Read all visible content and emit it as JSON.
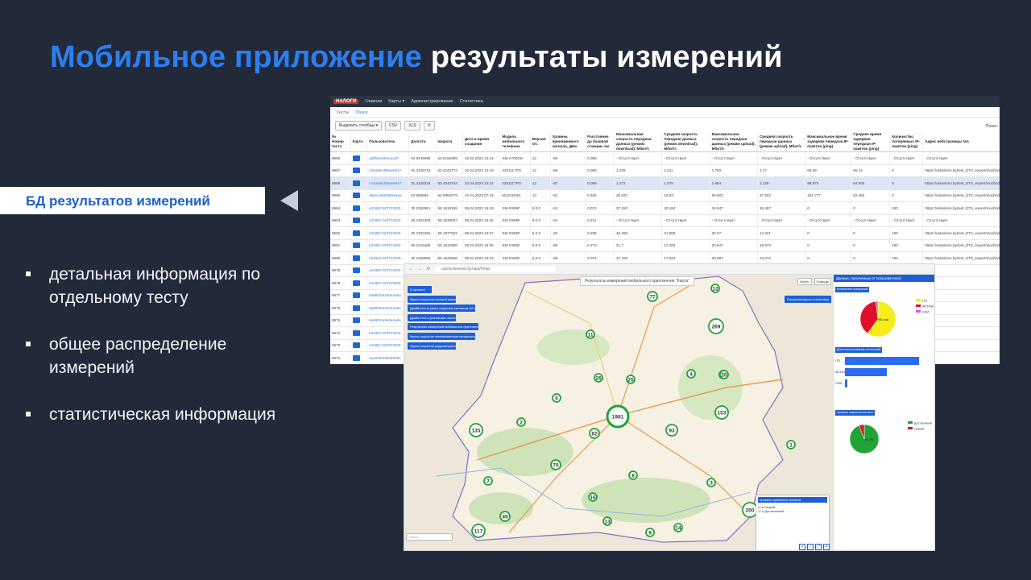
{
  "slide": {
    "title_highlight": "Мобильное приложение",
    "title_rest": "результаты измерений",
    "db_label": "БД результатов измерений",
    "bullets": [
      "детальная информация по отдельному тесту",
      "общее распределение измерений",
      "статистическая информация"
    ]
  },
  "colors": {
    "background": "#222a39",
    "accent": "#2d7ef0",
    "panel_blue": "#1f5fd6"
  },
  "web": {
    "logo": "НАЛОГИ",
    "menu": [
      "Главная",
      "Карты ▾",
      "Администрирование",
      "Статистика"
    ],
    "tabs": [
      "Тесты",
      "Поиск"
    ],
    "tool_buttons": [
      "Выделить столбцы ▾",
      "CSV",
      "XLS"
    ],
    "search_label": "Поиск:",
    "columns": [
      "№ Номер теста",
      "Карта",
      "Пользователь",
      "Долгота",
      "Широта",
      "Дата и время создания",
      "Модель мобильного телефона",
      "Версия ОС",
      "Уровень принимаемого сигнала, дБм",
      "Расстояние до базовой станции, км",
      "Максимальная скорость передачи данных (режим download), Мбит/с",
      "Средняя скорость передачи данных (режим download), Мбит/с",
      "Максимальная скорость передачи данных (режим upload), Мбит/с",
      "Средняя скорость передачи данных (режим upload), Мбит/с",
      "Максимальное время задержки передачи IP-пакетов (ping)",
      "Среднее время задержки передачи IP-пакетов (ping)",
      "Количество потерянных IP-пакетов (ping)",
      "Адрес вебстраницы №1",
      "Время загрузки вебстраницы №1, с",
      "Размер вебстраницы №1, кб",
      "Адрес вебстраницы №2"
    ],
    "rows": [
      [
        "9988",
        "a30f6ec6fe5acd2f",
        "53.9436995",
        "53.9150089",
        "10.04.2023 13:44",
        "SM-A705GE",
        "13",
        "-89",
        "0.008",
        "- Отсутствует",
        "- Отсутствует",
        "- Отсутствует",
        "- Отсутствует",
        "- Отсутствует",
        "- Отсутствует",
        "- Отсутствует",
        "- Отсутствует",
        "- Отсутствует",
        "- Отсутствует",
        "- Отсутствует"
      ],
      [
        "9987",
        "c44a58cd59ae6617",
        "31.3128744",
        "52.4243772",
        "10.04.2023 13:43",
        "2201117PG",
        "12",
        "-86",
        "0.008",
        "1.229",
        "1.011",
        "1.750",
        "1.17",
        "69.48",
        "65.12",
        "0",
        "https://ostankino.by/test_ETS_expert/mod/index.html",
        "2.808",
        "20",
        "https://ominer.by"
      ],
      [
        "9986",
        "c44a58cd59ae6617",
        "31.3128332",
        "52.4243744",
        "10.04.2023 13:42",
        "2201117PG",
        "12",
        "-87",
        "0.008",
        "1.272",
        "1.078",
        "1.864",
        "1.129",
        "98.973",
        "64.063",
        "0",
        "https://ostankino.by/test_ETS_expert/mod/index.html",
        "3.420",
        "20",
        "https://ominer.by"
      ],
      [
        "9985",
        "d80ec45899b8e6ea",
        "23.695992",
        "52.0964079",
        "10.04.2023 07:44",
        "M2101K6G",
        "13",
        "-82",
        "0.282",
        "25.937",
        "18.53",
        "93.603",
        "37.802",
        "151.777",
        "82.482",
        "0",
        "https://ostankino.by/test_ETS_expert/mod/index.html",
        "0.221",
        "20",
        "https://ominer.by"
      ],
      [
        "9984",
        "e3198c7e0f722000",
        "30.2282861",
        "55.1915368",
        "09.04.2023 16:45",
        "SM-G955F",
        "6.0.0",
        "-81",
        "0.074",
        "37.153",
        "20.184",
        "16.947",
        "16.497",
        "0",
        "0",
        "100",
        "https://ostankino.by/test_ETS_expert/mod/index.html",
        "0.258",
        "20",
        "https://ominer.by"
      ],
      [
        "9983",
        "e3198c7e0f722000",
        "30.2281308",
        "55.1930067",
        "09.04.2023 16:45",
        "SM-G955F",
        "6.0.0",
        "-84",
        "0.211",
        "- Отсутствует",
        "- Отсутствует",
        "- Отсутствует",
        "- Отсутствует",
        "- Отсутствует",
        "- Отсутствует",
        "- Отсутствует",
        "- Отсутствует",
        "- Отсутствует",
        "- Отсутствует",
        "- Отсутствует"
      ],
      [
        "9982",
        "e3198c7e0f722000",
        "30.2320155",
        "55.1977922",
        "09.04.2023 16:37",
        "SM-G955F",
        "6.0.0",
        "-82",
        "0.285",
        "45.259",
        "21.888",
        "20.57",
        "14.321",
        "0",
        "0",
        "100",
        "https://ostankino.by/test_ETS_expert/mod/index.html",
        "0.342",
        "20",
        "https://ominer.by"
      ],
      [
        "9981",
        "e3198c7e0f722000",
        "30.2216486",
        "55.1912988",
        "09.04.2023 16:35",
        "SM-G955F",
        "6.0.0",
        "-85",
        "0.273",
        "21.7",
        "12.282",
        "20.847",
        "18.973",
        "0",
        "0",
        "100",
        "https://ostankino.by/test_ETS_expert/mod/index.html",
        "0.275",
        "20",
        "https://ominer.by"
      ],
      [
        "9980",
        "e3198c7e0f722000",
        "30.2358968",
        "55.1843958",
        "09.04.2023 16:33",
        "SM-G955F",
        "6.0.0",
        "-85",
        "0.074",
        "37.159",
        "17.044",
        "29.887",
        "23.074",
        "0",
        "0",
        "100",
        "https://ostankino.by/test_ETS_expert/mod/index.html",
        "0.299",
        "20",
        "https://ominer.by"
      ],
      [
        "9979",
        "e3198c7e0f722000",
        "30.2",
        "",
        "",
        "",
        "",
        "",
        "",
        "",
        "",
        "",
        "",
        "",
        "",
        "",
        "",
        "",
        "",
        ""
      ],
      [
        "9978",
        "e3198c7e0f722000",
        "30.2",
        "",
        "",
        "",
        "",
        "",
        "",
        "",
        "",
        "",
        "",
        "",
        "",
        "",
        "",
        "",
        "",
        ""
      ],
      [
        "9977",
        "9a86f20e2e0e4a5a",
        "27.4",
        "",
        "",
        "",
        "",
        "",
        "",
        "",
        "",
        "",
        "",
        "",
        "",
        "",
        "",
        "",
        "",
        ""
      ],
      [
        "9976",
        "9a86f20e2e0e4a5a",
        "27.4",
        "",
        "",
        "",
        "",
        "",
        "",
        "",
        "",
        "",
        "",
        "",
        "",
        "",
        "",
        "",
        "",
        ""
      ],
      [
        "9975",
        "9a86f20e2e0e4a5a",
        "27.4",
        "",
        "",
        "",
        "",
        "",
        "",
        "",
        "",
        "",
        "",
        "",
        "",
        "",
        "",
        "",
        "",
        ""
      ],
      [
        "9974",
        "e3198c7e0f722000",
        "30.2",
        "",
        "",
        "",
        "",
        "",
        "",
        "",
        "",
        "",
        "",
        "",
        "",
        "",
        "",
        "",
        "",
        ""
      ],
      [
        "9973",
        "e3198c7e0f722000",
        "30.2",
        "",
        "",
        "",
        "",
        "",
        "",
        "",
        "",
        "",
        "",
        "",
        "",
        "",
        "",
        "",
        "",
        ""
      ],
      [
        "9972",
        "2aa240ebd5f28650",
        "27.5",
        "",
        "",
        "",
        "",
        "",
        "",
        "",
        "",
        "",
        "",
        "",
        "",
        "",
        "",
        "",
        "",
        ""
      ]
    ]
  },
  "map": {
    "url": "карта-анализ.by/app/rmap",
    "header": "Результаты измерений мобильного приложения \"Карта\"",
    "layers": [
      "О проекте",
      "Карты покрытия сотовой связи",
      "Драйв-тесты (зоны покрытия сигналом 4G и 5)",
      "Драйв-тесты (поисковое качество)",
      "Результаты измерений мобильного приложения \"Карта\"",
      "Карты покрытия телевизионным вещанием",
      "Карты покрытия радиовещанием"
    ],
    "top_buttons": [
      "Войти",
      "Помощь"
    ],
    "stat_button": "Показать/скрыть статистику",
    "search_placeholder": "Поиск",
    "legend_title": "Уровень принятого сигнала",
    "legend_items": [
      "Низкий",
      "Достаточный"
    ],
    "zoom": [
      "+",
      "−",
      "⤢",
      "⌖"
    ],
    "clusters": [
      {
        "label": "1981"
      },
      {
        "label": "269"
      },
      {
        "label": "200"
      },
      {
        "label": "153"
      },
      {
        "label": "135"
      },
      {
        "label": "117"
      },
      {
        "label": "93"
      },
      {
        "label": "82"
      },
      {
        "label": "77"
      },
      {
        "label": "70"
      },
      {
        "label": "49"
      },
      {
        "label": "16"
      },
      {
        "label": "14"
      },
      {
        "label": "12"
      },
      {
        "label": "11"
      },
      {
        "label": "8"
      },
      {
        "label": "7"
      },
      {
        "label": "6"
      },
      {
        "label": "5"
      },
      {
        "label": "4"
      },
      {
        "label": "3"
      },
      {
        "label": "2"
      },
      {
        "label": "1"
      },
      {
        "label": "20"
      },
      {
        "label": "26"
      },
      {
        "label": "25"
      },
      {
        "label": "13"
      },
      {
        "label": "9"
      }
    ]
  },
  "stats": {
    "header": "Данные, полученные от пользователей",
    "sections": [
      "Количество измерений",
      "Доля использования технологий",
      "Уровень покрытия сигнала"
    ],
    "pie1": {
      "slices": [
        {
          "label": "LTE",
          "value": 60,
          "color": "#f5ec1a"
        },
        {
          "label": "WCDMA",
          "value": 38,
          "color": "#e0102a"
        },
        {
          "label": "GSM",
          "value": 2,
          "color": "#c060e0"
        }
      ],
      "center_label": "1981 изм."
    },
    "bars": {
      "categories": [
        "LTE",
        "WCDMA",
        "GSM"
      ],
      "values": [
        92,
        52,
        3
      ]
    },
    "pie2": {
      "slices": [
        {
          "label": "Достаточный",
          "value": 94,
          "color": "#21a336"
        },
        {
          "label": "Низкий",
          "value": 6,
          "color": "#e0102a"
        }
      ],
      "center_label": "94.7%"
    }
  }
}
